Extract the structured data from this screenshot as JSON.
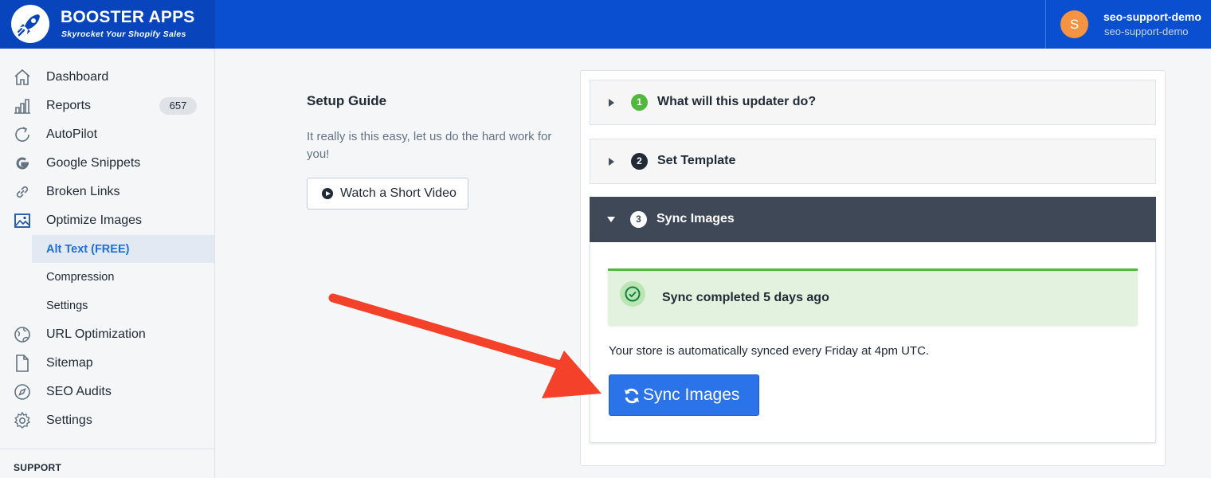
{
  "header": {
    "brand_title": "BOOSTER APPS",
    "brand_tagline": "Skyrocket Your Shopify Sales",
    "user_initial": "S",
    "user_name": "seo-support-demo",
    "user_shop": "seo-support-demo"
  },
  "sidebar": {
    "items": [
      {
        "label": "Dashboard",
        "icon": "home-icon"
      },
      {
        "label": "Reports",
        "icon": "bar-chart-icon",
        "badge": "657"
      },
      {
        "label": "AutoPilot",
        "icon": "refresh-arrow-icon"
      },
      {
        "label": "Google Snippets",
        "icon": "google-icon"
      },
      {
        "label": "Broken Links",
        "icon": "link-icon"
      },
      {
        "label": "Optimize Images",
        "icon": "image-icon"
      },
      {
        "label": "URL Optimization",
        "icon": "globe-icon"
      },
      {
        "label": "Sitemap",
        "icon": "document-icon"
      },
      {
        "label": "SEO Audits",
        "icon": "compass-icon"
      },
      {
        "label": "Settings",
        "icon": "gear-icon"
      }
    ],
    "sub_items": [
      {
        "label": "Alt Text (FREE)",
        "active": true
      },
      {
        "label": "Compression",
        "active": false
      },
      {
        "label": "Settings",
        "active": false
      }
    ],
    "section_heading": "SUPPORT"
  },
  "guide": {
    "title": "Setup Guide",
    "description": "It really is this easy, let us do the hard work for you!",
    "video_button": "Watch a Short Video"
  },
  "steps": [
    {
      "number": "1",
      "title": "What will this updater do?",
      "color": "#50b83c",
      "expanded": false
    },
    {
      "number": "2",
      "title": "Set Template",
      "color": "#212b36",
      "expanded": false
    },
    {
      "number": "3",
      "title": "Sync Images",
      "color": "#ffffff",
      "expanded": true
    }
  ],
  "sync": {
    "status_message": "Sync completed 5 days ago",
    "schedule_note": "Your store is automatically synced every Friday at 4pm UTC.",
    "button_label": "Sync Images"
  },
  "colors": {
    "header_bg": "#0a4fd0",
    "primary_button": "#2a73e8",
    "success_banner": "#e3f1df",
    "annotation_arrow": "#f4412a"
  }
}
